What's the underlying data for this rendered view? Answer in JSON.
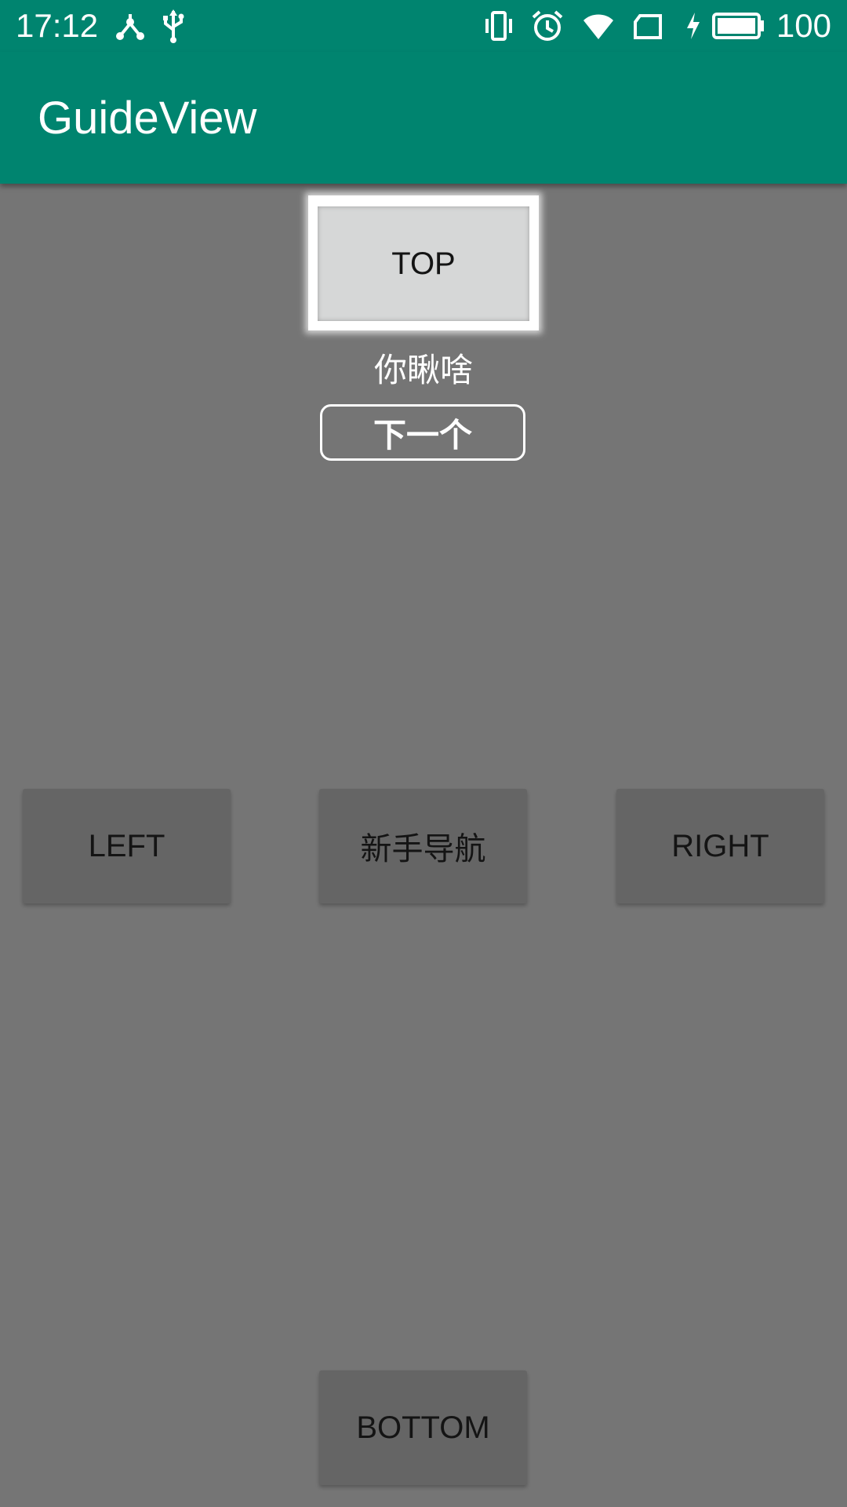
{
  "status_bar": {
    "time": "17:12",
    "battery": "100",
    "icons": [
      "share-icon",
      "usb-icon",
      "vibrate-icon",
      "alarm-icon",
      "wifi-icon",
      "sim-icon",
      "charging-icon",
      "battery-icon"
    ],
    "background_color": "#00846F"
  },
  "app_bar": {
    "title": "GuideView",
    "background_color": "#00846F"
  },
  "guide": {
    "highlighted_button": "TOP",
    "message": "你瞅啥",
    "next_label": "下一个",
    "overlay_color": "#757575"
  },
  "buttons": {
    "top": "TOP",
    "left": "LEFT",
    "center": "新手导航",
    "right": "RIGHT",
    "bottom": "BOTTOM"
  }
}
